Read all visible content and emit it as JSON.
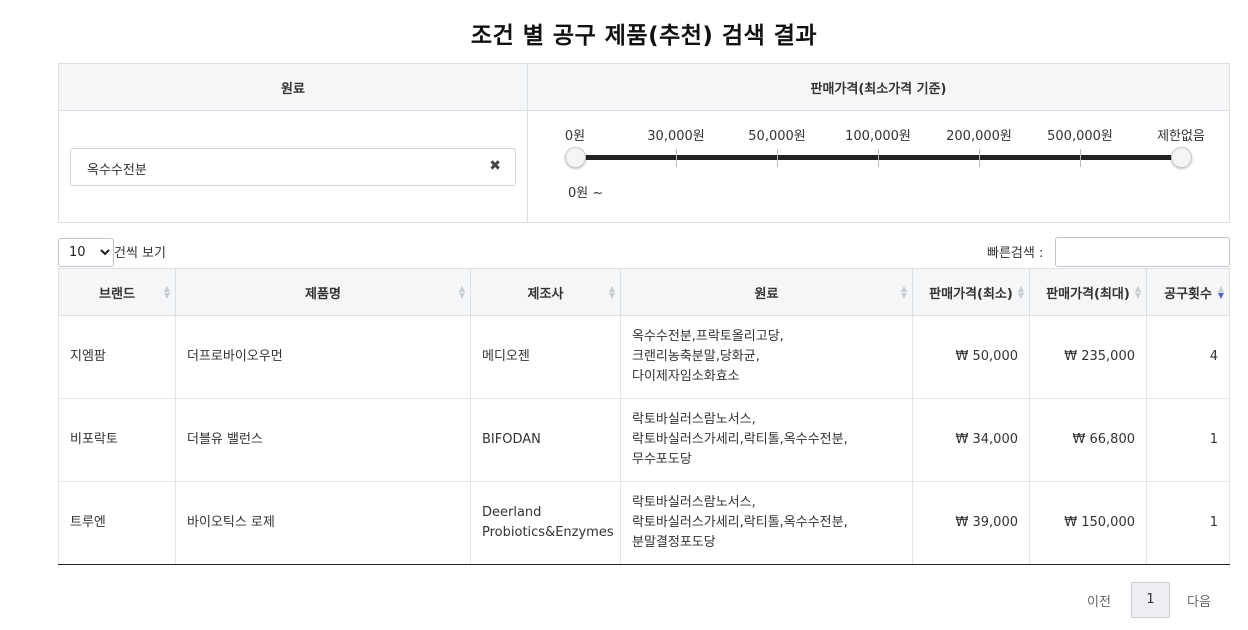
{
  "title": "조건 별 공구 제품(추천) 검색 결과",
  "filter": {
    "ingredient_header": "원료",
    "price_header": "판매가격(최소가격 기준)",
    "ingredient_tag": "옥수수전분",
    "clear_glyph": "✖",
    "price_labels": [
      "0원",
      "30,000원",
      "50,000원",
      "100,000원",
      "200,000원",
      "500,000원",
      "제한없음"
    ],
    "price_range": {
      "min_index": 0,
      "max_index": 6
    },
    "price_value": "0원 ~"
  },
  "controls": {
    "length_value": "10",
    "length_label": "건씩 보기",
    "search_label": "빠른검색 :",
    "search_value": ""
  },
  "table": {
    "columns": [
      "브랜드",
      "제품명",
      "제조사",
      "원료",
      "판매가격(최소)",
      "판매가격(최대)",
      "공구횟수"
    ],
    "rows": [
      {
        "brand": "지엠팜",
        "product": "더프로바이오우먼",
        "maker": "메디오젠",
        "ingredients": [
          "옥수수전분,프락토올리고당,",
          "크랜리농축분말,당화균,",
          "다이제자임소화효소"
        ],
        "min_price": "₩ 50,000",
        "max_price": "₩ 235,000",
        "count": "4"
      },
      {
        "brand": "비포락토",
        "product": "더블유 밸런스",
        "maker": "BIFODAN",
        "ingredients": [
          "락토바실러스람노서스,",
          "락토바실러스가세리,락티톨,옥수수전분,",
          "무수포도당"
        ],
        "min_price": "₩ 34,000",
        "max_price": "₩ 66,800",
        "count": "1"
      },
      {
        "brand": "트루엔",
        "product": "바이오틱스 로제",
        "maker": "Deerland Probiotics&Enzymes",
        "ingredients": [
          "락토바실러스람노서스,",
          "락토바실러스가세리,락티톨,옥수수전분,",
          "분말결정포도당"
        ],
        "min_price": "₩ 39,000",
        "max_price": "₩ 150,000",
        "count": "1"
      }
    ]
  },
  "pagination": {
    "prev": "이전",
    "current": "1",
    "next": "다음"
  },
  "colors": {
    "accent_sort": "#5561c9",
    "header_bg": "#f5f6f8",
    "track": "#222222"
  }
}
